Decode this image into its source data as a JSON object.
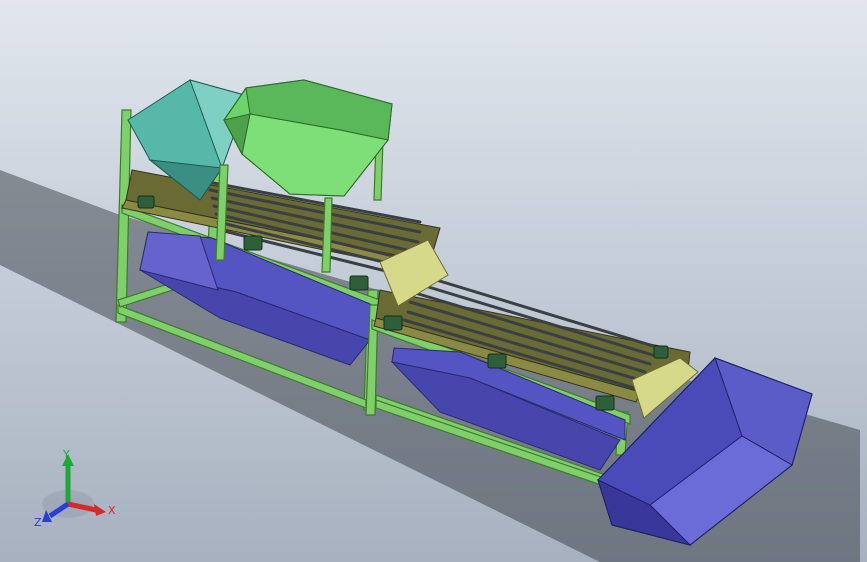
{
  "triad": {
    "x_label": "X",
    "y_label": "Y",
    "z_label": "Z",
    "x_color": "#d42a2a",
    "y_color": "#1ea83a",
    "z_color": "#2a3ed4"
  },
  "colors": {
    "frame": "#7fcf6a",
    "frame_dark": "#3f7a30",
    "hopper_green": "#6fd36b",
    "hopper_teal": "#55b8a8",
    "bin_blue": "#4a4ab8",
    "bin_blue_light": "#6c6cd8",
    "conveyor_olive": "#6a6a34",
    "chute_yellow": "#d7d98a",
    "roller": "#4d5358"
  }
}
